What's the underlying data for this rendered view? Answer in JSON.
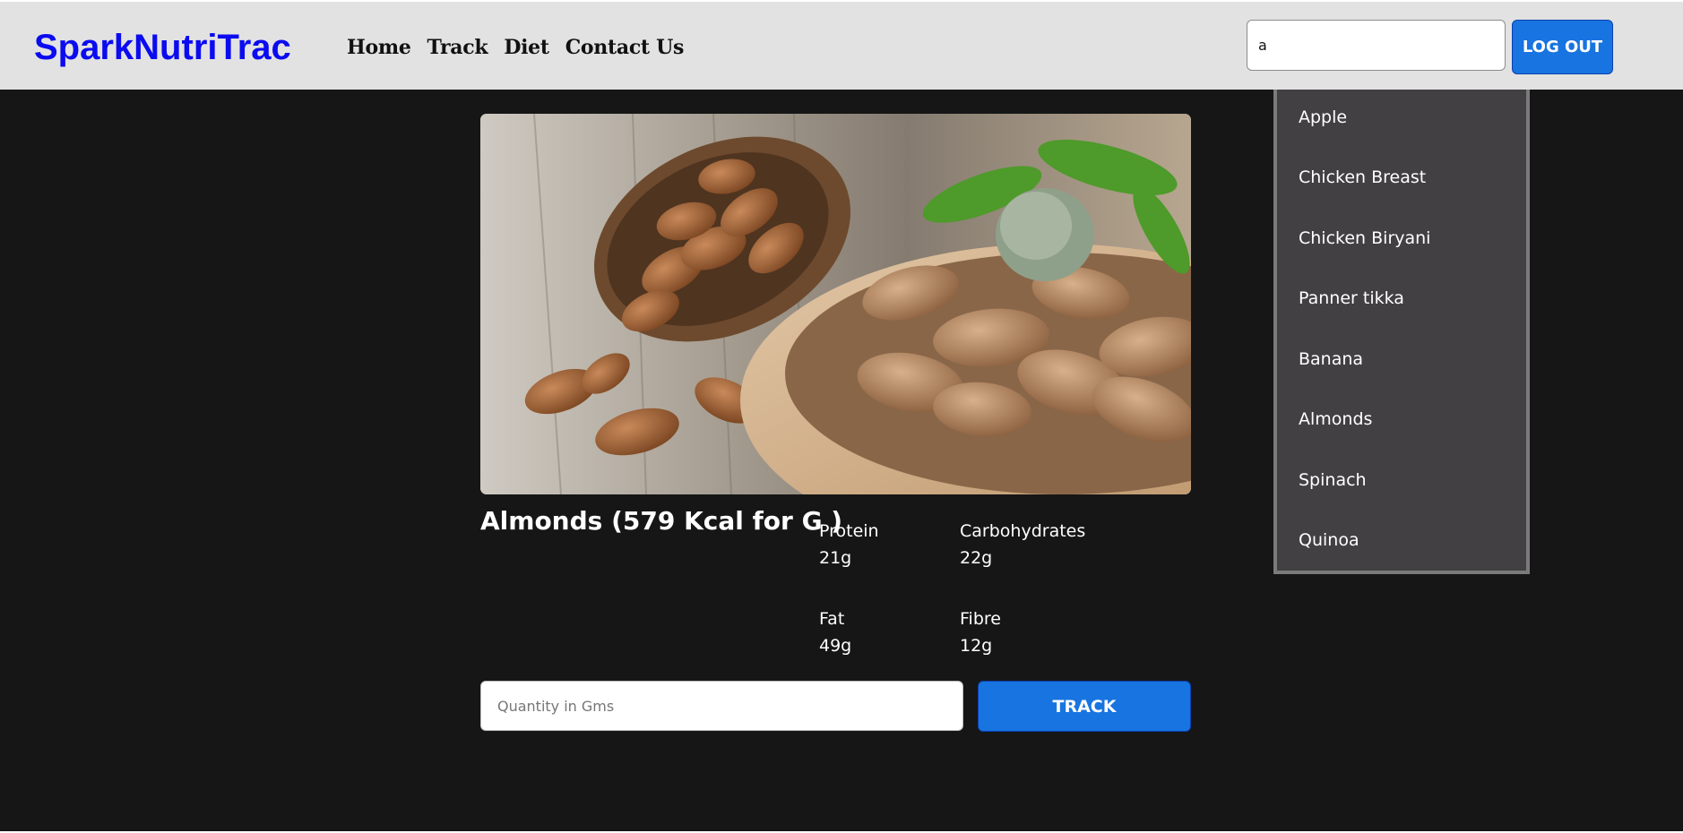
{
  "brand": "SparkNutriTrac",
  "nav": {
    "links": [
      "Home",
      "Track",
      "Diet",
      "Contact Us"
    ]
  },
  "search": {
    "value": "a"
  },
  "logout_label": "LOG OUT",
  "food": {
    "title": "Almonds (579 Kcal for G )",
    "image_alt": "almonds-photo",
    "nutrients": [
      {
        "label": "Protein",
        "value": "21g"
      },
      {
        "label": "Carbohydrates",
        "value": "22g"
      },
      {
        "label": "Fat",
        "value": "49g"
      },
      {
        "label": "Fibre",
        "value": "12g"
      }
    ]
  },
  "quantity": {
    "placeholder": "Quantity in Gms",
    "value": ""
  },
  "track_label": "TRACK",
  "dropdown": {
    "items": [
      "Apple",
      "Chicken Breast",
      "Chicken Biryani",
      "Panner tikka",
      "Banana",
      "Almonds",
      "Spinach",
      "Quinoa"
    ]
  },
  "colors": {
    "brand": "#0b0bf0",
    "primary_button": "#1874e0",
    "navbar_bg": "#e2e2e2",
    "page_bg": "#161616",
    "dropdown_bg": "#424042"
  }
}
